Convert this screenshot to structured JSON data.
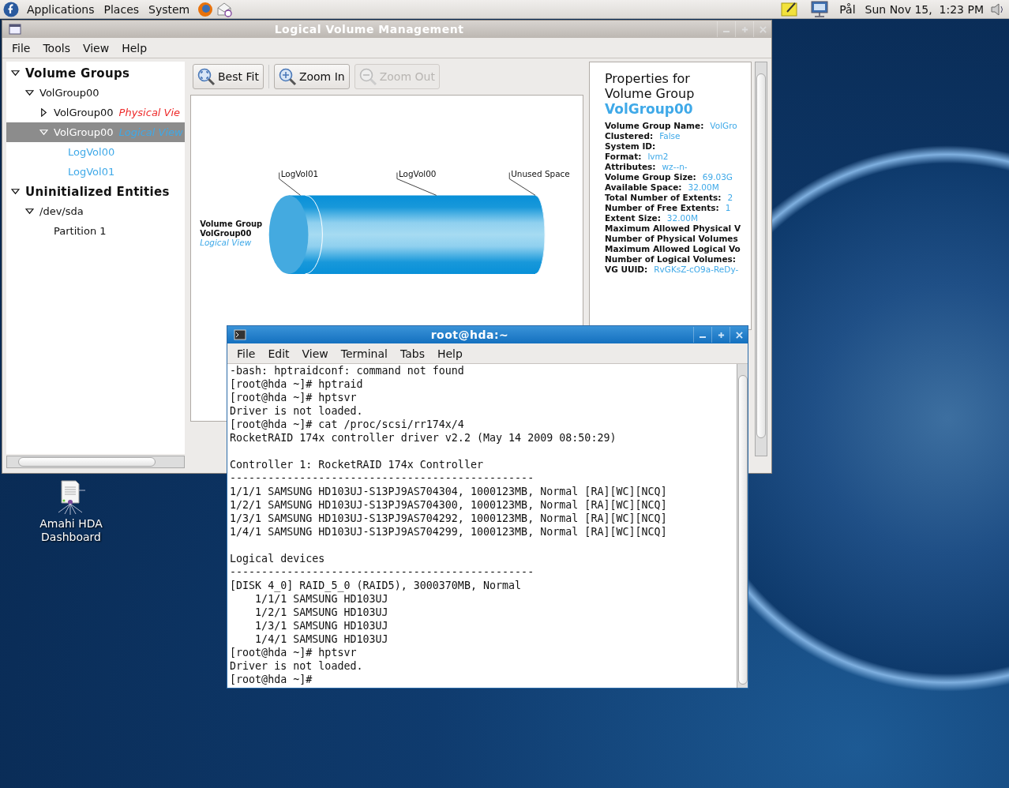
{
  "top_panel": {
    "menus": [
      "Applications",
      "Places",
      "System"
    ],
    "user": "Pål",
    "clock": "Sun Nov 15,  1:23 PM"
  },
  "lvm_window": {
    "title": "Logical Volume Management",
    "menu": [
      {
        "label": "File"
      },
      {
        "label": "Tools"
      },
      {
        "label": "View"
      },
      {
        "label": "Help"
      }
    ],
    "tree": [
      {
        "label": "Volume Groups",
        "kind": "section",
        "expanded": true,
        "selected": false,
        "children": [
          {
            "label": "VolGroup00",
            "kind": "node",
            "expanded": true,
            "selected": false,
            "children": [
              {
                "label": "VolGroup00",
                "suffix": "Physical Vie",
                "color": "#ee2b2b",
                "kind": "node",
                "expanded": false,
                "selected": false
              },
              {
                "label": "VolGroup00",
                "suffix": "Logical View",
                "color": "#3fa9e8",
                "kind": "node",
                "expanded": true,
                "selected": true,
                "children": [
                  {
                    "label": "LogVol00",
                    "kind": "volume",
                    "selected": false
                  },
                  {
                    "label": "LogVol01",
                    "kind": "volume",
                    "selected": false
                  }
                ]
              }
            ]
          }
        ]
      },
      {
        "label": "Uninitialized Entities",
        "kind": "section",
        "expanded": true,
        "selected": false,
        "children": [
          {
            "label": "/dev/sda",
            "kind": "node",
            "expanded": true,
            "selected": false,
            "children": [
              {
                "label": "Partition 1",
                "kind": "node",
                "selected": false
              }
            ]
          }
        ]
      }
    ],
    "toolbar": [
      {
        "label": "Best Fit",
        "kind": "fit",
        "disabled": false
      },
      {
        "label": "Zoom In",
        "kind": "zoom_in",
        "disabled": false
      },
      {
        "label": "Zoom Out",
        "kind": "zoom_out",
        "disabled": true
      }
    ],
    "diagram": {
      "group_label": "Volume Group",
      "group_name": "VolGroup00",
      "view": "Logical View",
      "segments": [
        "LogVol01",
        "LogVol00",
        "Unused Space"
      ]
    },
    "properties": {
      "heading": [
        "Properties for",
        "Volume Group"
      ],
      "name": "VolGroup00",
      "rows": [
        {
          "label": "Volume Group Name:",
          "value": "VolGro"
        },
        {
          "label": "Clustered:",
          "value": "False"
        },
        {
          "label": "System ID:"
        },
        {
          "label": "Format:",
          "value": "lvm2"
        },
        {
          "label": "Attributes:",
          "value": "wz--n-"
        },
        {
          "label": "Volume Group Size:",
          "value": "69.03G"
        },
        {
          "label": "Available Space:",
          "value": "32.00M"
        },
        {
          "label": "Total Number of Extents:",
          "value": "2"
        },
        {
          "label": "Number of Free Extents:",
          "value": "1"
        },
        {
          "label": "Extent Size:",
          "value": "32.00M"
        },
        {
          "label": "Maximum Allowed Physical V"
        },
        {
          "label": "Number of Physical Volumes"
        },
        {
          "label": "Maximum Allowed Logical Vo"
        },
        {
          "label": "Number of Logical Volumes:"
        },
        {
          "label": "VG UUID:",
          "value": "RvGKsZ-cO9a-ReDy-"
        }
      ]
    }
  },
  "terminal": {
    "title": "root@hda:~",
    "menu": [
      {
        "label": "File"
      },
      {
        "label": "Edit"
      },
      {
        "label": "View"
      },
      {
        "label": "Terminal"
      },
      {
        "label": "Tabs"
      },
      {
        "label": "Help"
      }
    ],
    "paragraphs": [
      [
        "-bash: hptraidconf: command not found",
        "[root@hda ~]# hptraid",
        "[root@hda ~]# hptsvr",
        "Driver is not loaded.",
        "[root@hda ~]# cat /proc/scsi/rr174x/4",
        "RocketRAID 174x controller driver v2.2 (May 14 2009 08:50:29)"
      ],
      [
        "Controller 1: RocketRAID 174x Controller",
        "------------------------------------------------",
        "1/1/1 SAMSUNG HD103UJ-S13PJ9AS704304, 1000123MB, Normal [RA][WC][NCQ]",
        "1/2/1 SAMSUNG HD103UJ-S13PJ9AS704300, 1000123MB, Normal [RA][WC][NCQ]",
        "1/3/1 SAMSUNG HD103UJ-S13PJ9AS704292, 1000123MB, Normal [RA][WC][NCQ]",
        "1/4/1 SAMSUNG HD103UJ-S13PJ9AS704299, 1000123MB, Normal [RA][WC][NCQ]"
      ],
      [
        "Logical devices",
        "------------------------------------------------",
        "[DISK 4_0] RAID_5_0 (RAID5), 3000370MB, Normal",
        "    1/1/1 SAMSUNG HD103UJ",
        "    1/2/1 SAMSUNG HD103UJ",
        "    1/3/1 SAMSUNG HD103UJ",
        "    1/4/1 SAMSUNG HD103UJ",
        "[root@hda ~]# hptsvr",
        "Driver is not loaded.",
        "[root@hda ~]#"
      ]
    ]
  },
  "desktop_icons": [
    {
      "label": "Amahi HDA Dashboard"
    }
  ]
}
